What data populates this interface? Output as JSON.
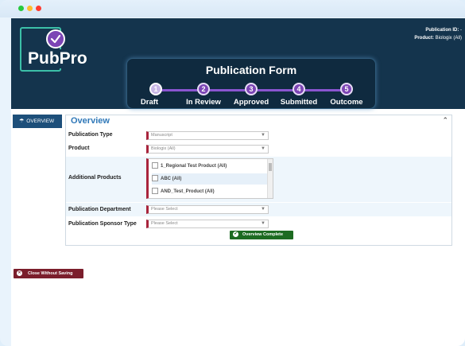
{
  "window": {
    "controls": [
      "close",
      "minimize",
      "maximize"
    ]
  },
  "header": {
    "logo_text": "PubPro",
    "publication_id_label": "Publication ID:",
    "publication_id_value": "-",
    "product_label": "Product:",
    "product_value": "Biologix (All)"
  },
  "form": {
    "title": "Publication Form",
    "steps": [
      {
        "number": "1",
        "label": "Draft",
        "active": true
      },
      {
        "number": "2",
        "label": "In Review",
        "active": false
      },
      {
        "number": "3",
        "label": "Approved",
        "active": false
      },
      {
        "number": "4",
        "label": "Submitted",
        "active": false
      },
      {
        "number": "5",
        "label": "Outcome",
        "active": false
      }
    ]
  },
  "sidebar": {
    "tab_label": "OVERVIEW"
  },
  "overview": {
    "title": "Overview",
    "fields": {
      "publication_type": {
        "label": "Publication Type",
        "value": "Manuscript"
      },
      "product": {
        "label": "Product",
        "value": "Biologix (All)"
      },
      "additional_products": {
        "label": "Additional Products",
        "options": [
          "1_Regional Test Product (All)",
          "ABC (All)",
          "AND_Test_Product (All)"
        ]
      },
      "publication_department": {
        "label": "Publication Department",
        "placeholder": "Please Select"
      },
      "publication_sponsor_type": {
        "label": "Publication Sponsor Type",
        "placeholder": "Please Select"
      }
    },
    "complete_button": "Overview Complete"
  },
  "footer": {
    "close_button": "Close Without Saving"
  },
  "colors": {
    "header_bg": "#14344d",
    "accent_purple": "#7c45b5",
    "required_marker": "#a8243c",
    "complete_green": "#1d6b22",
    "close_red": "#7b1e2c",
    "title_blue": "#2f78b8"
  },
  "icons": {
    "logo": "check-badge-icon",
    "sidebar": "umbrella-icon",
    "dropdown": "chevron-down-icon",
    "collapse": "chevron-up-icon",
    "complete": "check-circle-icon",
    "close": "close-circle-icon"
  }
}
